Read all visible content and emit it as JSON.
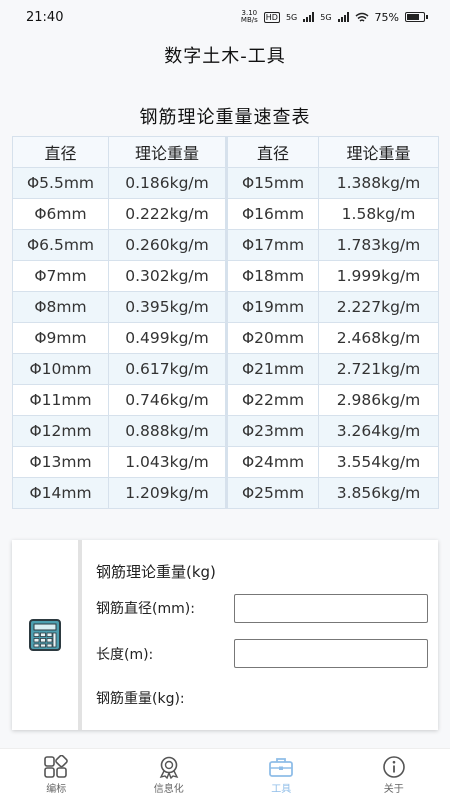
{
  "status_bar": {
    "time": "21:40",
    "net_speed_value": "3.10",
    "net_speed_unit": "MB/s",
    "hd_badge": "HD",
    "sim1_label": "5G",
    "sim2_label": "5G",
    "battery": "75%"
  },
  "header": {
    "title": "数字土木-工具"
  },
  "weight_table": {
    "title": "钢筋理论重量速查表",
    "headers": [
      "直径",
      "理论重量",
      "直径",
      "理论重量"
    ],
    "rows": [
      [
        "Φ5.5mm",
        "0.186kg/m",
        "Φ15mm",
        "1.388kg/m"
      ],
      [
        "Φ6mm",
        "0.222kg/m",
        "Φ16mm",
        "1.58kg/m"
      ],
      [
        "Φ6.5mm",
        "0.260kg/m",
        "Φ17mm",
        "1.783kg/m"
      ],
      [
        "Φ7mm",
        "0.302kg/m",
        "Φ18mm",
        "1.999kg/m"
      ],
      [
        "Φ8mm",
        "0.395kg/m",
        "Φ19mm",
        "2.227kg/m"
      ],
      [
        "Φ9mm",
        "0.499kg/m",
        "Φ20mm",
        "2.468kg/m"
      ],
      [
        "Φ10mm",
        "0.617kg/m",
        "Φ21mm",
        "2.721kg/m"
      ],
      [
        "Φ11mm",
        "0.746kg/m",
        "Φ22mm",
        "2.986kg/m"
      ],
      [
        "Φ12mm",
        "0.888kg/m",
        "Φ23mm",
        "3.264kg/m"
      ],
      [
        "Φ13mm",
        "1.043kg/m",
        "Φ24mm",
        "3.554kg/m"
      ],
      [
        "Φ14mm",
        "1.209kg/m",
        "Φ25mm",
        "3.856kg/m"
      ]
    ]
  },
  "calculator": {
    "icon": "calculator-icon",
    "title": "钢筋理论重量(kg)",
    "diameter_label": "钢筋直径(mm):",
    "diameter_value": "",
    "length_label": "长度(m):",
    "length_value": "",
    "weight_label": "钢筋重量(kg):"
  },
  "bottom_nav": {
    "items": [
      {
        "label": "编标",
        "icon": "grid-icon",
        "active": false
      },
      {
        "label": "信息化",
        "icon": "badge-icon",
        "active": false
      },
      {
        "label": "工具",
        "icon": "toolbox-icon",
        "active": true
      },
      {
        "label": "关于",
        "icon": "info-icon",
        "active": false
      }
    ]
  },
  "colors": {
    "active_tab": "#8fbde8",
    "table_border": "#d6e1ec",
    "table_stripe": "#eef6fb",
    "calculator_icon": "#4d9fb0"
  }
}
